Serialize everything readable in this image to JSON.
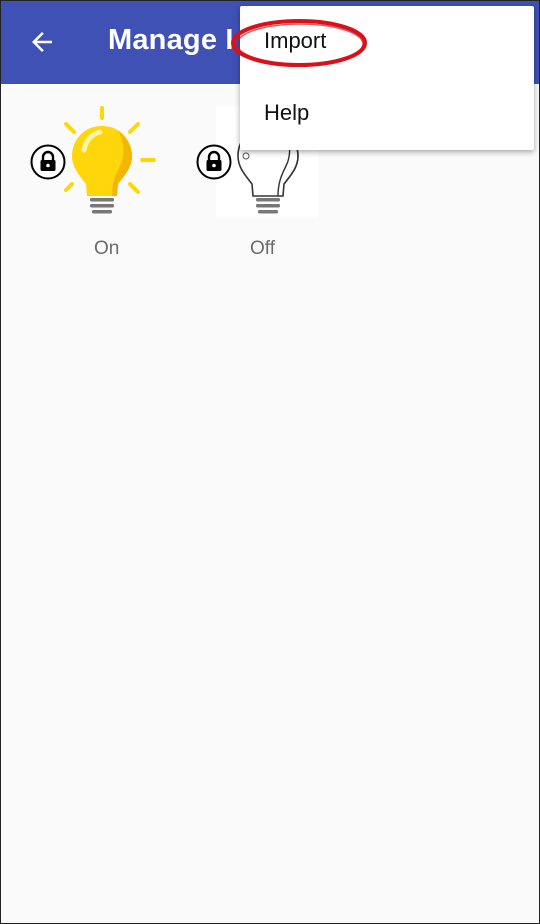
{
  "app_bar": {
    "title": "Manage I",
    "back_icon": "arrow-left-icon",
    "color": "#3f51b5"
  },
  "items": [
    {
      "label": "On",
      "icon": "lightbulb-on-icon",
      "lock_icon": "lock-icon",
      "bulb_color": "#ffd60a"
    },
    {
      "label": "Off",
      "icon": "lightbulb-off-icon",
      "lock_icon": "lock-icon"
    }
  ],
  "overflow_menu": {
    "items": [
      {
        "label": "Import",
        "highlighted": true
      },
      {
        "label": "Help"
      }
    ],
    "highlight_color": "#d8111b"
  }
}
